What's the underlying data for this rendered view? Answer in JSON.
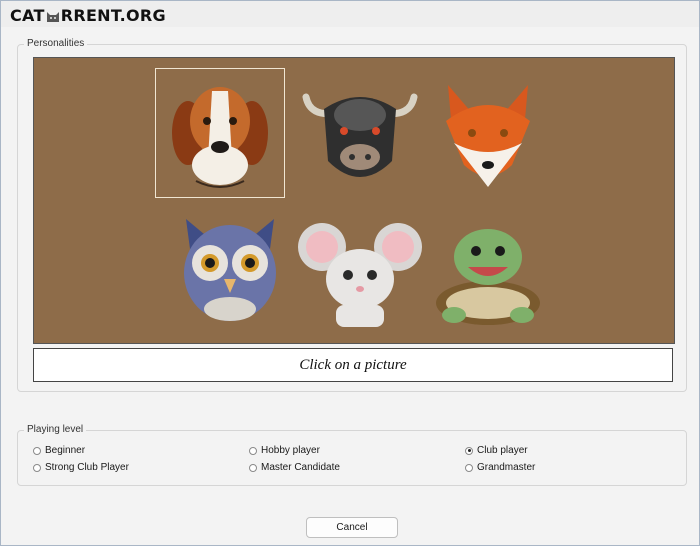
{
  "watermark": {
    "part1": "CAT",
    "part2": "RRENT.ORG"
  },
  "personalities": {
    "legend": "Personalities",
    "animals": [
      {
        "name": "beagle-portrait",
        "selected": true
      },
      {
        "name": "bull-portrait",
        "selected": false
      },
      {
        "name": "fox-portrait",
        "selected": false
      },
      {
        "name": "owl-portrait",
        "selected": false
      },
      {
        "name": "mouse-portrait",
        "selected": false
      },
      {
        "name": "turtle-portrait",
        "selected": false
      }
    ],
    "caption": "Click on a picture",
    "background_color": "#8e6c49"
  },
  "playing_level": {
    "legend": "Playing level",
    "options": [
      {
        "label": "Beginner",
        "checked": false
      },
      {
        "label": "Hobby player",
        "checked": false
      },
      {
        "label": "Club player",
        "checked": true
      },
      {
        "label": "Strong Club Player",
        "checked": false
      },
      {
        "label": "Master Candidate",
        "checked": false
      },
      {
        "label": "Grandmaster",
        "checked": false
      }
    ]
  },
  "buttons": {
    "cancel": "Cancel"
  }
}
